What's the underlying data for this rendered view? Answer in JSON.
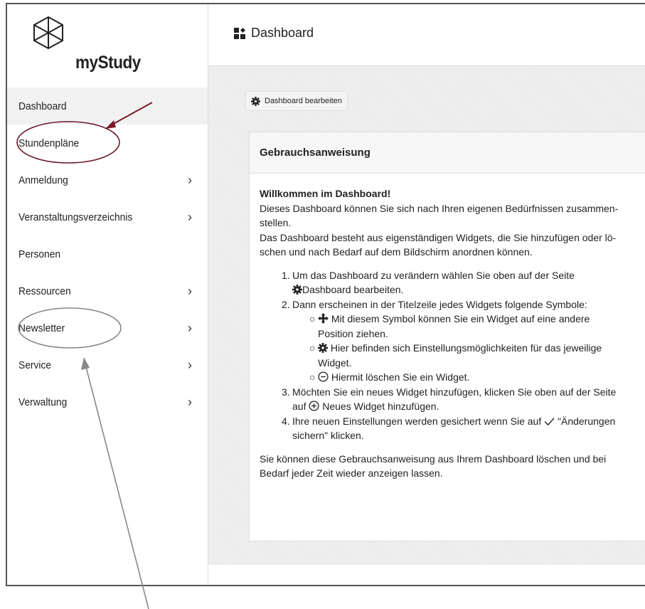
{
  "app": {
    "logo_text": "myStudy"
  },
  "sidebar": {
    "items": [
      {
        "label": "Dashboard",
        "chevron": false,
        "active": true
      },
      {
        "label": "Stundenpläne",
        "chevron": false
      },
      {
        "label": "Anmeldung",
        "chevron": true
      },
      {
        "label": "Veranstaltungsverzeichnis",
        "chevron": true
      },
      {
        "label": "Personen",
        "chevron": false
      },
      {
        "label": "Ressourcen",
        "chevron": true
      },
      {
        "label": "Newsletter",
        "chevron": true
      },
      {
        "label": "Service",
        "chevron": true
      },
      {
        "label": "Verwaltung",
        "chevron": true
      }
    ],
    "chevron_glyph": "›"
  },
  "header": {
    "title": "Dashboard",
    "icon": "dashboard-icon"
  },
  "toolbar": {
    "edit_label": "Dashboard bearbeiten",
    "icon": "gear-icon"
  },
  "widget": {
    "title": "Gebrauchsanweisung",
    "welcome": "Willkommen im Dashboard!",
    "intro_1": "Dieses Dashboard können Sie sich nach Ihren eigenen Bedürfnissen zusammen-",
    "intro_2": "stellen.",
    "intro_3": "Das Dashboard besteht aus eigenständigen Widgets, die Sie hinzufügen oder lö-",
    "intro_4": "schen und nach Bedarf auf dem Bildschirm anordnen können.",
    "step1_num": "1.",
    "step1_a": "Um das Dashboard zu verändern wählen Sie oben auf der Seite",
    "step1_b": "Dashboard bearbeiten.",
    "step2_num": "2.",
    "step2": "Dann erscheinen in der Titelzeile jedes Widgets folgende Symbole:",
    "sub_bullet": "○",
    "sub1_a": "Mit diesem Symbol können Sie ein Widget auf eine andere",
    "sub1_b": "Position ziehen.",
    "sub2_a": "Hier befinden sich Einstellungsmöglichkeiten für das jeweilige",
    "sub2_b": "Widget.",
    "sub3": "Hiermit löschen Sie ein Widget.",
    "step3_num": "3.",
    "step3_a": "Möchten Sie ein neues Widget hinzufügen, klicken Sie oben auf der Seite",
    "step3_pre": "auf",
    "step3_b": "Neues Widget hinzufügen.",
    "step4_num": "4.",
    "step4_a": "Ihre neuen Einstellungen werden gesichert wenn Sie auf",
    "step4_b": "\"Änderungen",
    "step4_c": "sichern\" klicken.",
    "outro_1": "Sie können diese Gebrauchsanweisung aus Ihrem Dashboard löschen und bei",
    "outro_2": "Bedarf jeder Zeit wieder anzeigen lassen."
  },
  "annotations": {
    "arrow_color": "#7a1a2a",
    "ellipse_color": "#6b1a2a",
    "grey_color": "#888888"
  }
}
